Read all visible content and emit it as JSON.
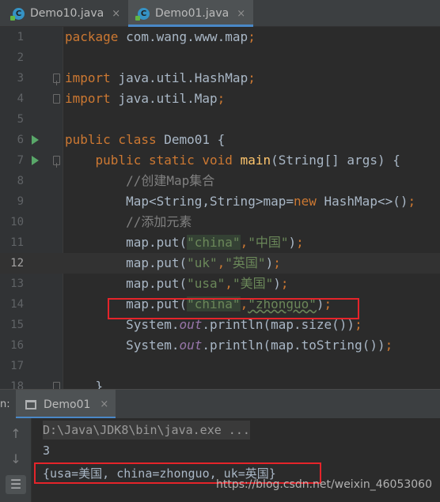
{
  "tabs": [
    {
      "label": "Demo10.java",
      "close": "×"
    },
    {
      "label": "Demo01.java",
      "close": "×"
    }
  ],
  "editor": {
    "lines": [
      {
        "num": "1",
        "tokens": [
          {
            "t": "package ",
            "c": "kw"
          },
          {
            "t": "com.wang.www.map",
            "c": ""
          },
          {
            "t": ";",
            "c": "kw"
          }
        ]
      },
      {
        "num": "2",
        "tokens": []
      },
      {
        "num": "3",
        "tokens": [
          {
            "t": "import ",
            "c": "kw"
          },
          {
            "t": "java.util.HashMap",
            "c": ""
          },
          {
            "t": ";",
            "c": "kw"
          }
        ]
      },
      {
        "num": "4",
        "tokens": [
          {
            "t": "import ",
            "c": "kw"
          },
          {
            "t": "java.util.Map",
            "c": ""
          },
          {
            "t": ";",
            "c": "kw"
          }
        ]
      },
      {
        "num": "5",
        "tokens": []
      },
      {
        "num": "6",
        "tokens": [
          {
            "t": "public class ",
            "c": "kw"
          },
          {
            "t": "Demo01 {",
            "c": ""
          }
        ]
      },
      {
        "num": "7",
        "tokens": [
          {
            "t": "    public static void ",
            "c": "kw"
          },
          {
            "t": "main",
            "c": "fn"
          },
          {
            "t": "(String[] args) {",
            "c": ""
          }
        ]
      },
      {
        "num": "8",
        "tokens": [
          {
            "t": "        //创建Map集合",
            "c": "cmt"
          }
        ]
      },
      {
        "num": "9",
        "tokens": [
          {
            "t": "        Map<String,String>map=",
            "c": ""
          },
          {
            "t": "new ",
            "c": "kw"
          },
          {
            "t": "HashMap<>()",
            "c": ""
          },
          {
            "t": ";",
            "c": "kw"
          }
        ]
      },
      {
        "num": "10",
        "tokens": [
          {
            "t": "        //添加元素",
            "c": "cmt"
          }
        ]
      },
      {
        "num": "11",
        "tokens": [
          {
            "t": "        map.put(",
            "c": ""
          },
          {
            "t": "\"china\"",
            "c": "strhl"
          },
          {
            "t": ",",
            "c": "kw"
          },
          {
            "t": "\"中国\"",
            "c": "str"
          },
          {
            "t": ")",
            "c": ""
          },
          {
            "t": ";",
            "c": "kw"
          }
        ]
      },
      {
        "num": "12",
        "tokens": [
          {
            "t": "        map.put(",
            "c": ""
          },
          {
            "t": "\"uk\"",
            "c": "str"
          },
          {
            "t": ",",
            "c": "kw"
          },
          {
            "t": "\"英国\"",
            "c": "str"
          },
          {
            "t": ")",
            "c": ""
          },
          {
            "t": ";",
            "c": "kw"
          }
        ]
      },
      {
        "num": "13",
        "tokens": [
          {
            "t": "        map.put(",
            "c": ""
          },
          {
            "t": "\"usa\"",
            "c": "str"
          },
          {
            "t": ",",
            "c": "kw"
          },
          {
            "t": "\"美国\"",
            "c": "str"
          },
          {
            "t": ")",
            "c": ""
          },
          {
            "t": ";",
            "c": "kw"
          }
        ]
      },
      {
        "num": "14",
        "tokens": [
          {
            "t": "        map.put(",
            "c": ""
          },
          {
            "t": "\"china\"",
            "c": "strhl"
          },
          {
            "t": ",",
            "c": "kw"
          },
          {
            "t": "\"zhonguo\"",
            "c": "warn"
          },
          {
            "t": ")",
            "c": ""
          },
          {
            "t": ";",
            "c": "kw"
          }
        ]
      },
      {
        "num": "15",
        "tokens": [
          {
            "t": "        System.",
            "c": ""
          },
          {
            "t": "out",
            "c": "fld"
          },
          {
            "t": ".println(map.size())",
            "c": ""
          },
          {
            "t": ";",
            "c": "kw"
          }
        ]
      },
      {
        "num": "16",
        "tokens": [
          {
            "t": "        System.",
            "c": ""
          },
          {
            "t": "out",
            "c": "fld"
          },
          {
            "t": ".println(map.toString())",
            "c": ""
          },
          {
            "t": ";",
            "c": "kw"
          }
        ]
      },
      {
        "num": "17",
        "tokens": []
      },
      {
        "num": "18",
        "tokens": [
          {
            "t": "    }",
            "c": ""
          }
        ]
      }
    ],
    "current_line": "12"
  },
  "run_panel": {
    "side_label": "n:",
    "tab_label": "Demo01",
    "tab_close": "×",
    "buttons": [
      {
        "name": "scroll-up-button",
        "glyph": "↑"
      },
      {
        "name": "scroll-down-button",
        "glyph": "↓"
      },
      {
        "name": "soft-wrap-button",
        "glyph": "☰"
      }
    ],
    "output": [
      "D:\\Java\\JDK8\\bin\\java.exe ...",
      "3",
      "{usa=美国, china=zhonguo, uk=英国}"
    ]
  },
  "watermark": "https://blog.csdn.net/weixin_46053060",
  "colors": {
    "keyword": "#cc7832",
    "string": "#6a8759",
    "comment": "#808080",
    "method": "#ffc66d",
    "field": "#9876aa",
    "highlight_box": "#e5242a",
    "tab_accent": "#4a88c7",
    "run_arrow": "#59a869"
  }
}
